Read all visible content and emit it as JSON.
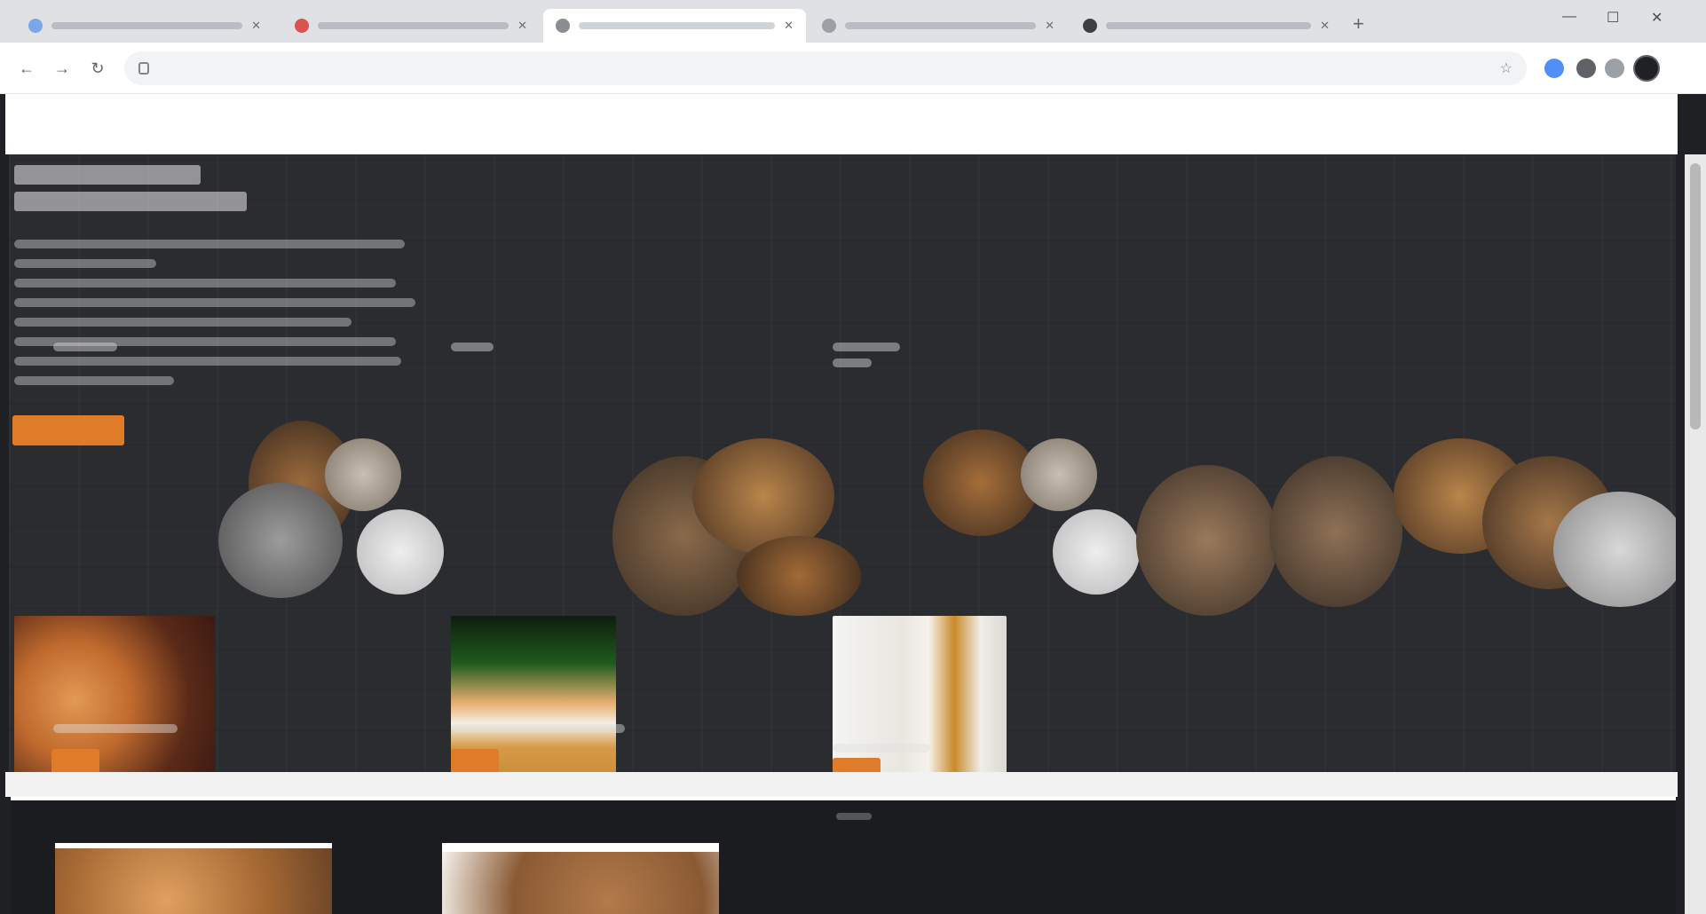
{
  "browser": {
    "tabs": [
      {
        "title": "",
        "active": false
      },
      {
        "title": "",
        "active": false
      },
      {
        "title": "",
        "active": true
      },
      {
        "title": "",
        "active": false
      },
      {
        "title": "",
        "active": false
      }
    ],
    "address": ""
  },
  "nav": {
    "items": [
      "",
      "",
      "",
      "",
      ""
    ]
  },
  "hero": {
    "title": "",
    "description": "",
    "cta": ""
  },
  "products": [
    {
      "name": "",
      "description": "",
      "button": ""
    },
    {
      "name": "",
      "description": "",
      "button": ""
    },
    {
      "name": "",
      "description": "",
      "button": ""
    }
  ],
  "second_section": {
    "title": ""
  },
  "colors": {
    "accent": "#e07b2a",
    "nav_link": "#9e4fcf",
    "hero_bg": "#2b2c30"
  }
}
